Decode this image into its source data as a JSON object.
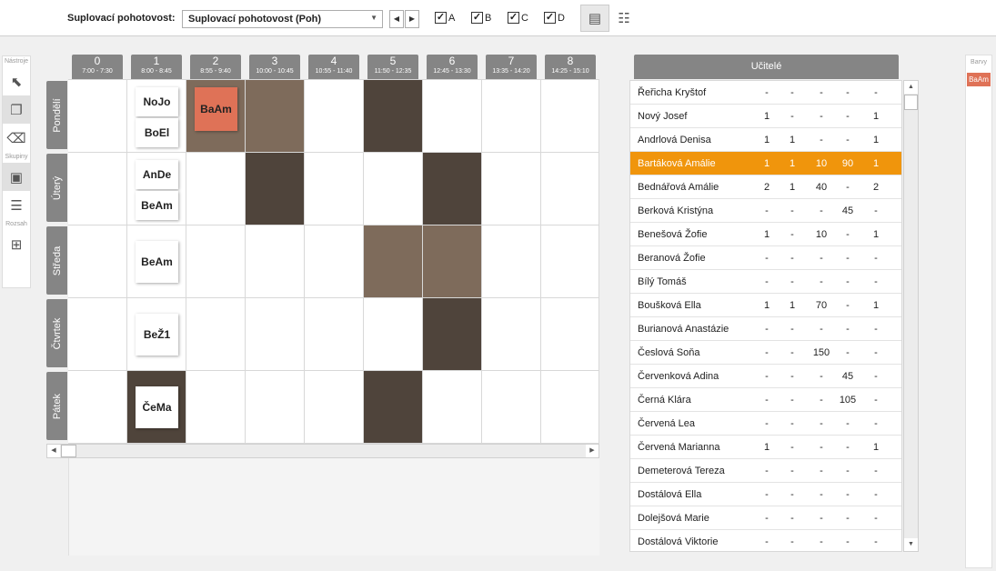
{
  "toolbar": {
    "label": "Suplovací pohotovost:",
    "select_value": "Suplovací pohotovost (Poh)",
    "checkboxes": [
      {
        "label": "A",
        "checked": true
      },
      {
        "label": "B",
        "checked": true
      },
      {
        "label": "C",
        "checked": true
      },
      {
        "label": "D",
        "checked": true
      }
    ]
  },
  "tools": {
    "section1": "Nástroje",
    "section2": "Skupiny",
    "section3": "Rozsah"
  },
  "periods": [
    {
      "num": "0",
      "time": "7:00 - 7:30"
    },
    {
      "num": "1",
      "time": "8:00 - 8:45"
    },
    {
      "num": "2",
      "time": "8:55 - 9:40"
    },
    {
      "num": "3",
      "time": "10:00 - 10:45"
    },
    {
      "num": "4",
      "time": "10:55 - 11:40"
    },
    {
      "num": "5",
      "time": "11:50 - 12:35"
    },
    {
      "num": "6",
      "time": "12:45 - 13:30"
    },
    {
      "num": "7",
      "time": "13:35 - 14:20"
    },
    {
      "num": "8",
      "time": "14:25 - 15:10"
    }
  ],
  "days": [
    "Pondělí",
    "Úterý",
    "Středa",
    "Čtvrtek",
    "Pátek"
  ],
  "shaded_cells": [
    {
      "day": 0,
      "period": 2,
      "shade": "mid"
    },
    {
      "day": 0,
      "period": 3,
      "shade": "mid"
    },
    {
      "day": 0,
      "period": 5,
      "shade": "dark"
    },
    {
      "day": 1,
      "period": 3,
      "shade": "dark"
    },
    {
      "day": 1,
      "period": 6,
      "shade": "dark"
    },
    {
      "day": 2,
      "period": 5,
      "shade": "mid"
    },
    {
      "day": 2,
      "period": 6,
      "shade": "mid"
    },
    {
      "day": 3,
      "period": 6,
      "shade": "dark"
    },
    {
      "day": 4,
      "period": 1,
      "shade": "dark"
    },
    {
      "day": 4,
      "period": 5,
      "shade": "dark"
    }
  ],
  "cards": [
    {
      "day": 0,
      "period": 1,
      "slot": 0,
      "of": 2,
      "label": "NoJo"
    },
    {
      "day": 0,
      "period": 1,
      "slot": 1,
      "of": 2,
      "label": "BoEl"
    },
    {
      "day": 0,
      "period": 2,
      "slot": 0,
      "of": 1,
      "label": "BaAm",
      "highlight": true
    },
    {
      "day": 1,
      "period": 1,
      "slot": 0,
      "of": 2,
      "label": "AnDe"
    },
    {
      "day": 1,
      "period": 1,
      "slot": 1,
      "of": 2,
      "label": "BeAm"
    },
    {
      "day": 2,
      "period": 1,
      "slot": 0,
      "of": 1,
      "label": "BeAm"
    },
    {
      "day": 3,
      "period": 1,
      "slot": 0,
      "of": 1,
      "label": "BeŽ1"
    },
    {
      "day": 4,
      "period": 1,
      "slot": 0,
      "of": 1,
      "label": "ČeMa"
    }
  ],
  "teachers_panel": {
    "title": "Učitelé",
    "rows": [
      {
        "name": "Řeřicha Kryštof",
        "values": [
          "-",
          "-",
          "-",
          "-",
          "-"
        ]
      },
      {
        "name": "Nový Josef",
        "values": [
          "1",
          "-",
          "-",
          "-",
          "1"
        ]
      },
      {
        "name": "Andrlová Denisa",
        "values": [
          "1",
          "1",
          "-",
          "-",
          "1"
        ]
      },
      {
        "name": "Bartáková Amálie",
        "values": [
          "1",
          "1",
          "10",
          "90",
          "1"
        ],
        "selected": true
      },
      {
        "name": "Bednářová Amálie",
        "values": [
          "2",
          "1",
          "40",
          "-",
          "2"
        ]
      },
      {
        "name": "Berková Kristýna",
        "values": [
          "-",
          "-",
          "-",
          "45",
          "-"
        ]
      },
      {
        "name": "Benešová Žofie",
        "values": [
          "1",
          "-",
          "10",
          "-",
          "1"
        ]
      },
      {
        "name": "Beranová Žofie",
        "values": [
          "-",
          "-",
          "-",
          "-",
          "-"
        ]
      },
      {
        "name": "Bílý Tomáš",
        "values": [
          "-",
          "-",
          "-",
          "-",
          "-"
        ]
      },
      {
        "name": "Boušková Ella",
        "values": [
          "1",
          "1",
          "70",
          "-",
          "1"
        ]
      },
      {
        "name": "Burianová Anastázie",
        "values": [
          "-",
          "-",
          "-",
          "-",
          "-"
        ]
      },
      {
        "name": "Česlová Soňa",
        "values": [
          "-",
          "-",
          "150",
          "-",
          "-"
        ]
      },
      {
        "name": "Červenková Adina",
        "values": [
          "-",
          "-",
          "-",
          "45",
          "-"
        ]
      },
      {
        "name": "Černá Klára",
        "values": [
          "-",
          "-",
          "-",
          "105",
          "-"
        ]
      },
      {
        "name": "Červená Lea",
        "values": [
          "-",
          "-",
          "-",
          "-",
          "-"
        ]
      },
      {
        "name": "Červená Marianna",
        "values": [
          "1",
          "-",
          "-",
          "-",
          "1"
        ]
      },
      {
        "name": "Demeterová Tereza",
        "values": [
          "-",
          "-",
          "-",
          "-",
          "-"
        ]
      },
      {
        "name": "Dostálová Ella",
        "values": [
          "-",
          "-",
          "-",
          "-",
          "-"
        ]
      },
      {
        "name": "Dolejšová Marie",
        "values": [
          "-",
          "-",
          "-",
          "-",
          "-"
        ]
      },
      {
        "name": "Dostálová Viktorie",
        "values": [
          "-",
          "-",
          "-",
          "-",
          "-"
        ]
      }
    ]
  },
  "colors_panel": {
    "title": "Barvy",
    "items": [
      "BaAm"
    ]
  },
  "colors": {
    "selected_row": "#f0950c",
    "highlight_card": "#df7257",
    "dark_cell": "#4f443b",
    "mid_cell": "#7e6b5b",
    "header_gray": "#858585"
  }
}
